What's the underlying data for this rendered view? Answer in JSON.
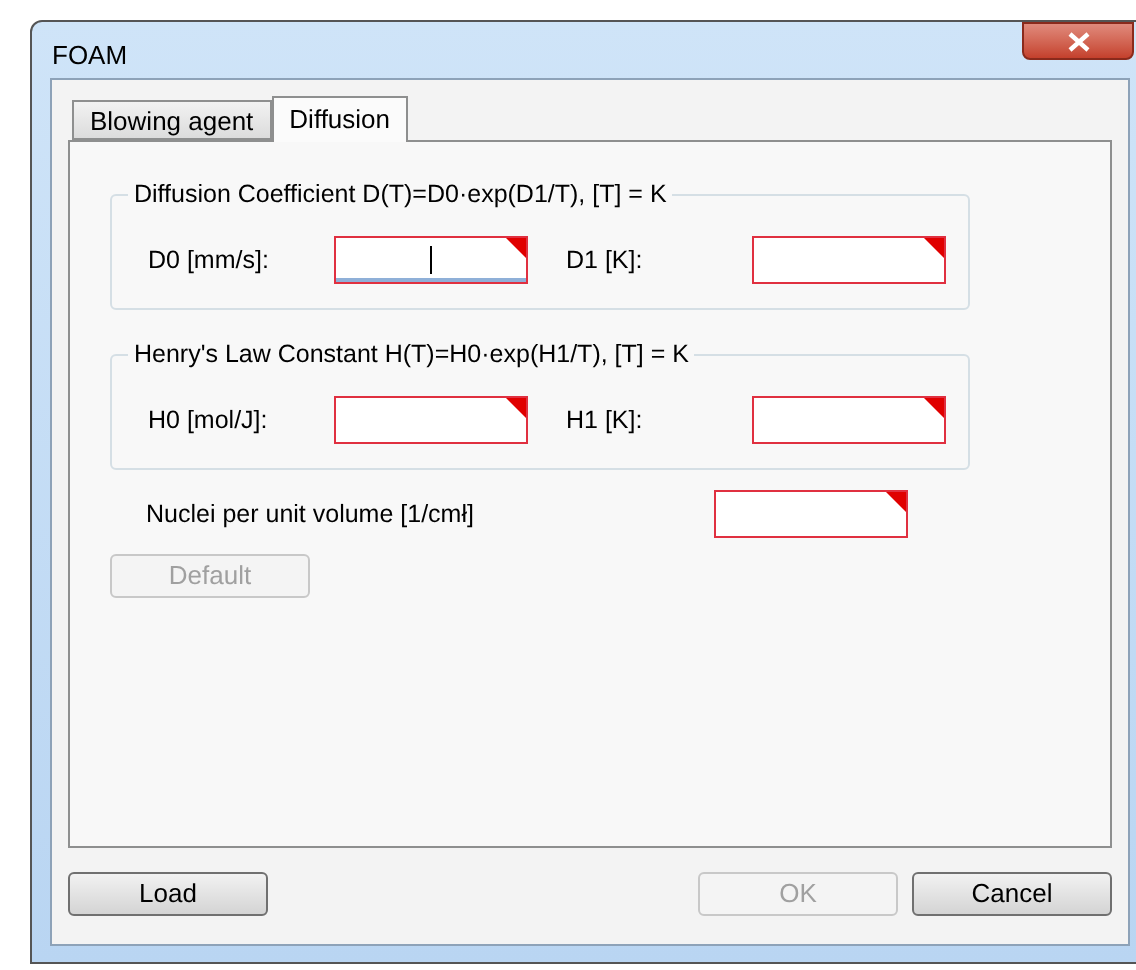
{
  "window": {
    "title": "FOAM"
  },
  "tabs": [
    {
      "label": "Blowing agent",
      "selected": false
    },
    {
      "label": "Diffusion",
      "selected": true
    }
  ],
  "groups": [
    {
      "title": "Diffusion Coefficient D(T)=D0·exp(D1/T), [T] = K",
      "fields": [
        {
          "label": "D0 [mm/s]:",
          "invalid": true,
          "focused": true
        },
        {
          "label": "D1 [K]:",
          "invalid": true,
          "focused": false
        }
      ]
    },
    {
      "title": "Henry's Law Constant H(T)=H0·exp(H1/T), [T] = K",
      "fields": [
        {
          "label": "H0 [mol/J]:",
          "invalid": true,
          "focused": false
        },
        {
          "label": "H1 [K]:",
          "invalid": true,
          "focused": false
        }
      ]
    }
  ],
  "nuclei_field": {
    "label": "Nuclei per unit volume [1/cmł]",
    "invalid": true,
    "focused": false
  },
  "default_button": {
    "label": "Default",
    "disabled": true
  },
  "buttons": [
    {
      "label": "Load",
      "disabled": false
    },
    {
      "label": "OK",
      "disabled": true
    },
    {
      "label": "Cancel",
      "disabled": false
    }
  ]
}
